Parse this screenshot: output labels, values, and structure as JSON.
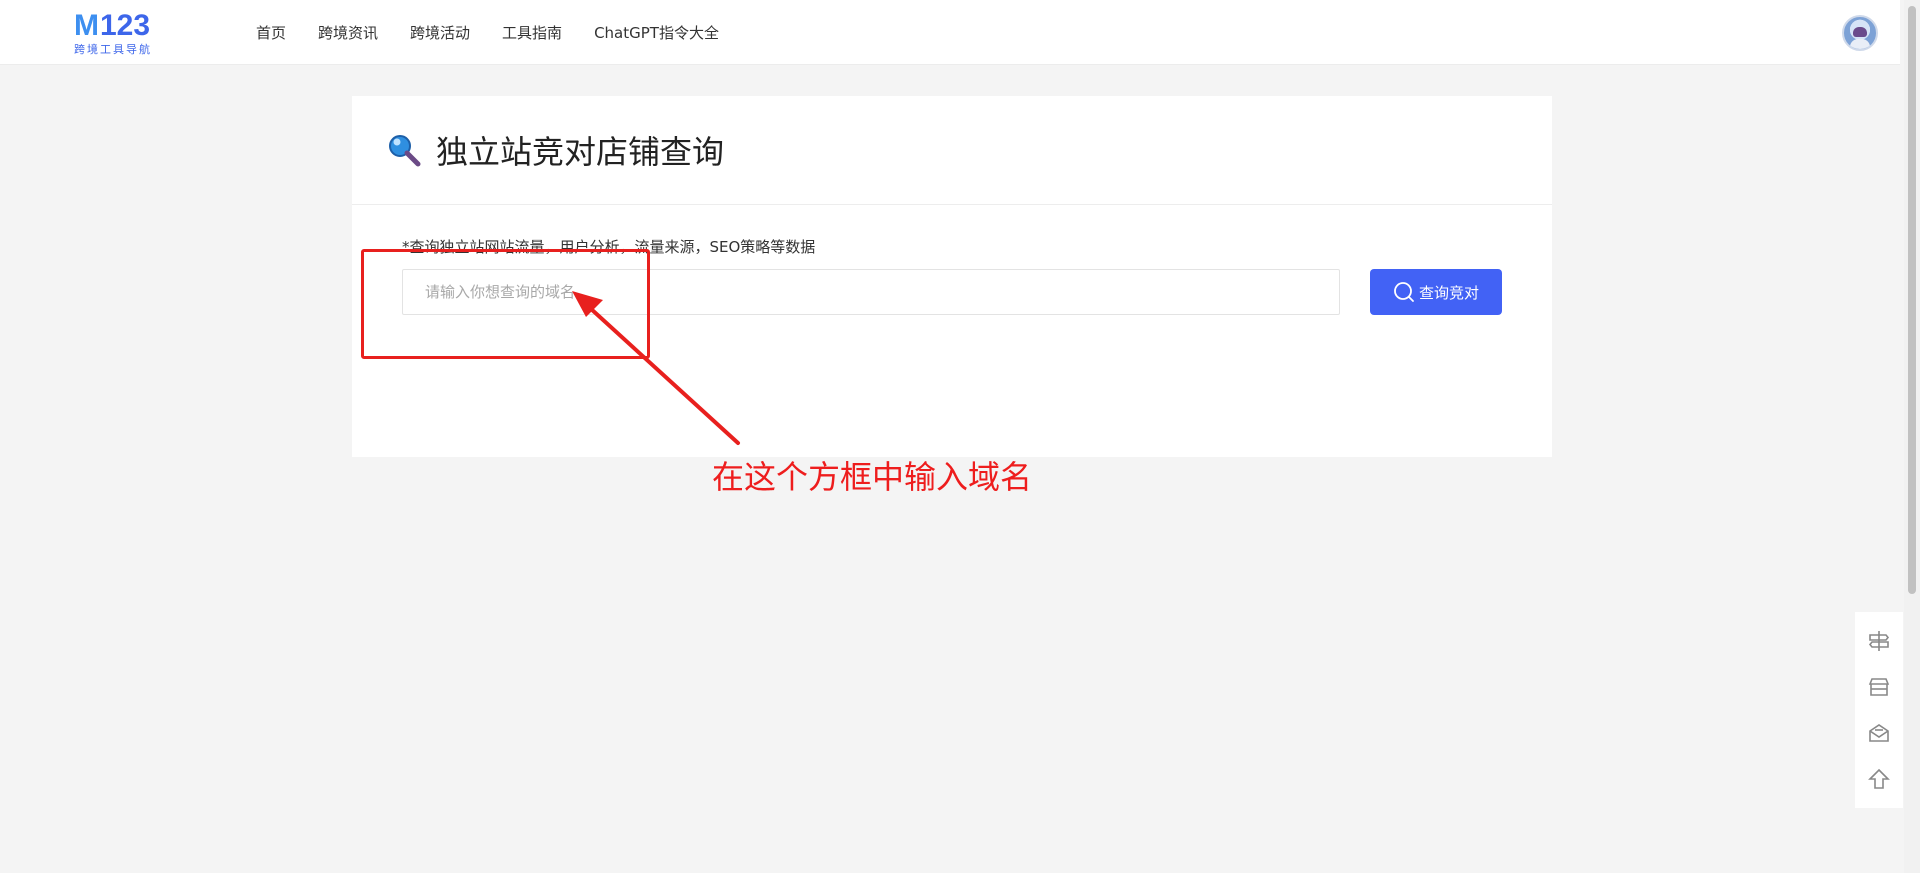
{
  "logo": {
    "mark_m": "M",
    "mark_num": "123",
    "subtitle": "跨境工具导航"
  },
  "nav": {
    "items": [
      {
        "label": "首页"
      },
      {
        "label": "跨境资讯"
      },
      {
        "label": "跨境活动"
      },
      {
        "label": "工具指南"
      },
      {
        "label": "ChatGPT指令大全"
      }
    ]
  },
  "page": {
    "title": "独立站竞对店铺查询",
    "hint": "*查询独立站网站流量，用户分析，流量来源，SEO策略等数据"
  },
  "search": {
    "placeholder": "请输入你想查询的域名",
    "value": "",
    "button_label": "查询竞对"
  },
  "annotation": {
    "text": "在这个方框中输入域名",
    "color": "#ee1d1d"
  },
  "side_tools": [
    {
      "icon": "signpost-icon"
    },
    {
      "icon": "store-icon"
    },
    {
      "icon": "mail-open-icon"
    },
    {
      "icon": "arrow-up-icon"
    }
  ],
  "colors": {
    "brand": "#4262f5",
    "logo_blue": "#3d66ea",
    "background": "#f4f4f4"
  }
}
